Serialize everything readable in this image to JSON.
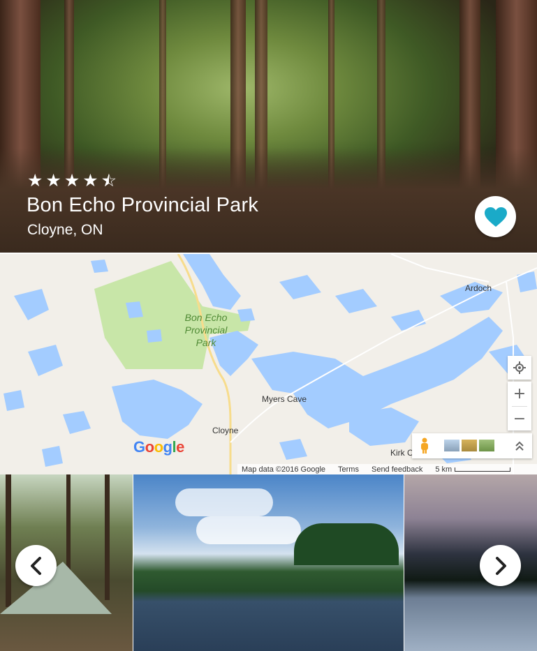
{
  "park": {
    "name": "Bon Echo Provincial Park",
    "location": "Cloyne, ON",
    "rating": 4.5,
    "rating_max": 5
  },
  "map": {
    "labels": {
      "park": "Bon Echo Provincial Park",
      "ardoch": "Ardoch",
      "myers_cave": "Myers Cave",
      "cloyne": "Cloyne",
      "kirk": "Kirk C"
    },
    "logo": "Google",
    "attribution": {
      "map_data": "Map data ©2016 Google",
      "terms": "Terms",
      "feedback": "Send feedback",
      "scale": "5 km"
    },
    "zoom_in": "+",
    "zoom_out": "−"
  },
  "icons": {
    "favorite": "heart-icon",
    "prev": "chevron-left-icon",
    "next": "chevron-right-icon",
    "location": "my-location-icon",
    "pegman": "pegman-icon",
    "expand": "chevron-up-double-icon"
  },
  "colors": {
    "accent": "#1aaac8",
    "water": "#a3ccff",
    "park_green": "#c8e6a8"
  }
}
